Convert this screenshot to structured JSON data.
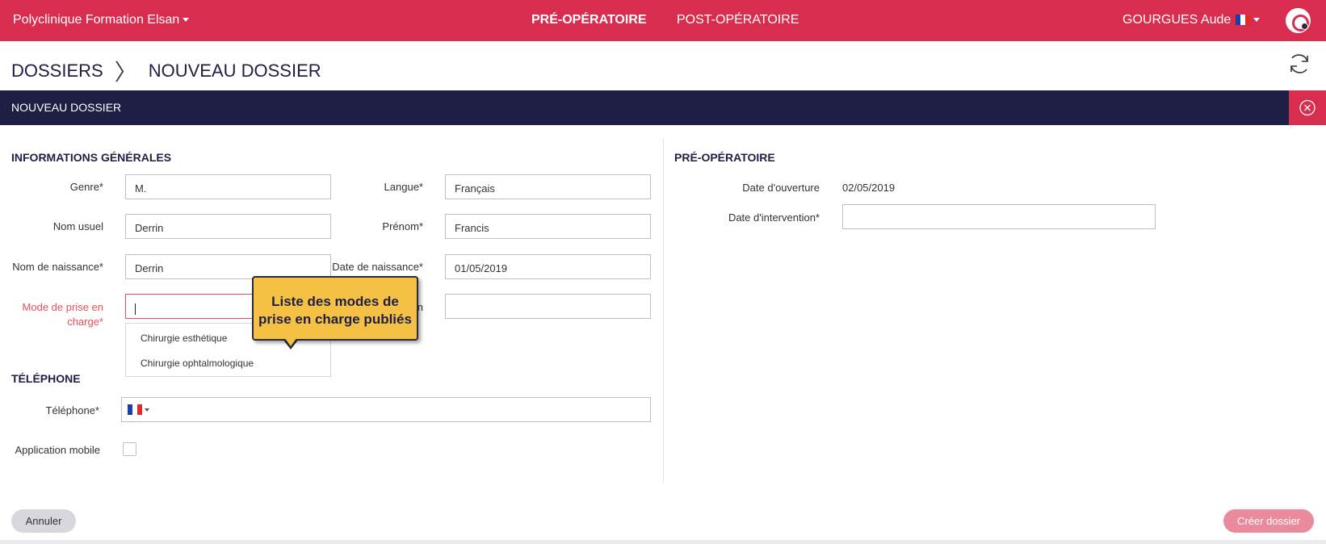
{
  "header": {
    "clinic": "Polyclinique Formation Elsan",
    "tabs": [
      {
        "label": "PRÉ-OPÉRATOIRE",
        "active": true
      },
      {
        "label": "POST-OPÉRATOIRE",
        "active": false
      }
    ],
    "user": "GOURGUES Aude",
    "brand_color": "#d92d4f"
  },
  "breadcrumb": {
    "root": "DOSSIERS",
    "current": "NOUVEAU DOSSIER"
  },
  "section": {
    "title": "NOUVEAU DOSSIER"
  },
  "general": {
    "heading": "INFORMATIONS GÉNÉRALES",
    "genre_label": "Genre*",
    "genre_value": "M.",
    "langue_label": "Langue*",
    "langue_value": "Français",
    "nom_usuel_label": "Nom usuel",
    "nom_usuel_value": "Derrin",
    "prenom_label": "Prénom*",
    "prenom_value": "Francis",
    "nom_naissance_label": "Nom de naissance*",
    "nom_naissance_value": "Derrin",
    "date_naissance_label": "Date de naissance*",
    "date_naissance_value": "01/05/2019",
    "mode_label_line1": "Mode de prise en",
    "mode_label_line2": "charge*",
    "hidden_label_fragment": "n",
    "mode_options": [
      "Chirurgie esthétique",
      "Chirurgie ophtalmologique"
    ]
  },
  "callout": {
    "line1": "Liste des modes de",
    "line2": "prise en charge publiés"
  },
  "phone": {
    "heading": "TÉLÉPHONE",
    "label": "Téléphone*",
    "mobile_app_label": "Application mobile"
  },
  "preop": {
    "heading": "PRÉ-OPÉRATOIRE",
    "opening_label": "Date d'ouverture",
    "opening_value": "02/05/2019",
    "intervention_label": "Date d'intervention*"
  },
  "actions": {
    "cancel": "Annuler",
    "create": "Créer dossier"
  }
}
